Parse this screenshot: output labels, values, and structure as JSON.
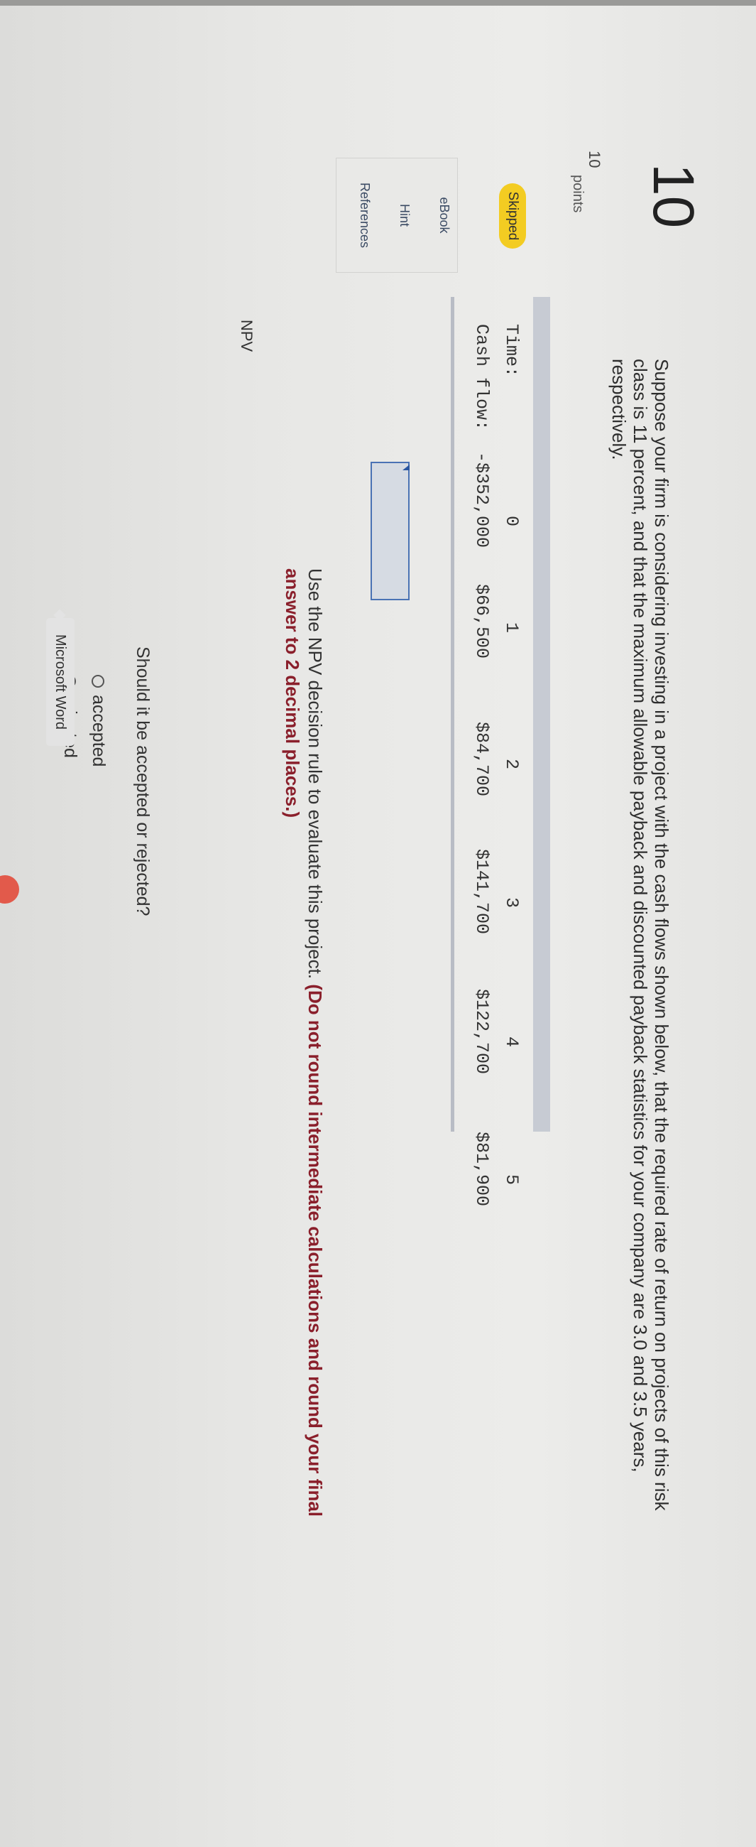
{
  "question": {
    "number": "10",
    "points_value": "10",
    "points_label": "points",
    "status": "Skipped",
    "text": "Suppose your firm is considering investing in a project with the cash flows shown below, that the required rate of return on projects of this risk class is 11 percent, and that the maximum allowable payback and discounted payback statistics for your company are 3.0 and 3.5 years, respectively."
  },
  "side_tools": {
    "ebook": "eBook",
    "hint": "Hint",
    "references": "References"
  },
  "cash_flows": {
    "time_label": "Time:",
    "cash_label": "Cash flow:",
    "periods": [
      "0",
      "1",
      "2",
      "3",
      "4",
      "5"
    ],
    "values": [
      "-$352,000",
      "$66,500",
      "$84,700",
      "$141,700",
      "$122,700",
      "$81,900"
    ]
  },
  "instruction": {
    "plain": "Use the NPV decision rule to evaluate this project. ",
    "bold": "(Do not round intermediate calculations and round your final answer to 2 decimal places.)"
  },
  "npv": {
    "label": "NPV",
    "value": ""
  },
  "decision": {
    "question": "Should it be accepted or rejected?",
    "options": [
      "accepted",
      "rejected"
    ]
  },
  "tooltip": "Microsoft Word",
  "colors": {
    "status_badge": "#f3cc22",
    "instruction_bold": "#8a1f2b",
    "input_border": "#3a63a8"
  }
}
